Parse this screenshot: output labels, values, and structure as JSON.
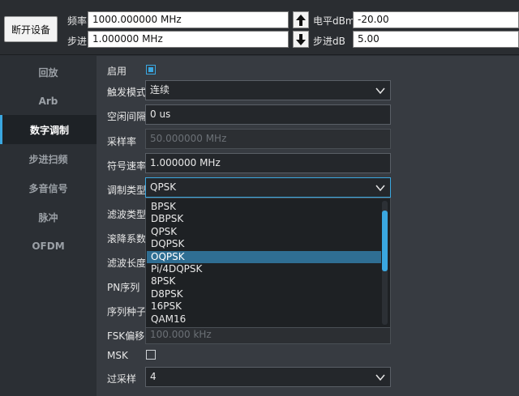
{
  "topbar": {
    "disconnect_label": "断开设备",
    "freq_label": "频率",
    "freq_value": "1000.000000 MHz",
    "step_label": "步进",
    "step_value": "1.000000 MHz",
    "level_label": "电平dBm",
    "level_value": "-20.00",
    "level_step_label": "步进dB",
    "level_step_value": "5.00"
  },
  "sidebar": {
    "items": [
      {
        "label": "回放",
        "active": false
      },
      {
        "label": "Arb",
        "active": false
      },
      {
        "label": "数字调制",
        "active": true
      },
      {
        "label": "步进扫频",
        "active": false
      },
      {
        "label": "多音信号",
        "active": false
      },
      {
        "label": "脉冲",
        "active": false
      },
      {
        "label": "OFDM",
        "active": false
      }
    ]
  },
  "form": {
    "enable_label": "启用",
    "enable_checked": true,
    "trigger_label": "触发模式",
    "trigger_value": "连续",
    "idle_label": "空闲间隔",
    "idle_value": "0 us",
    "samplerate_label": "采样率",
    "samplerate_value": "50.000000 MHz",
    "symbolrate_label": "符号速率",
    "symbolrate_value": "1.000000 MHz",
    "modtype_label": "调制类型",
    "modtype_value": "QPSK",
    "filtertype_label": "滤波类型",
    "rolloff_label": "滚降系数",
    "filterlen_label": "滤波长度",
    "pn_label": "PN序列",
    "seed_label": "序列种子",
    "fsk_label": "FSK偏移",
    "fsk_value": "100.000 kHz",
    "msk_label": "MSK",
    "msk_checked": false,
    "oversample_label": "过采样",
    "oversample_value": "4"
  },
  "dropdown": {
    "options": [
      "BPSK",
      "DBPSK",
      "QPSK",
      "DQPSK",
      "OQPSK",
      "Pi/4DQPSK",
      "8PSK",
      "D8PSK",
      "16PSK",
      "QAM16"
    ],
    "highlighted": "OQPSK"
  },
  "colors": {
    "accent": "#3aa7e0",
    "selected_option": "#2f6e93",
    "background": "#373b41",
    "sidebar": "#2b2f34"
  }
}
